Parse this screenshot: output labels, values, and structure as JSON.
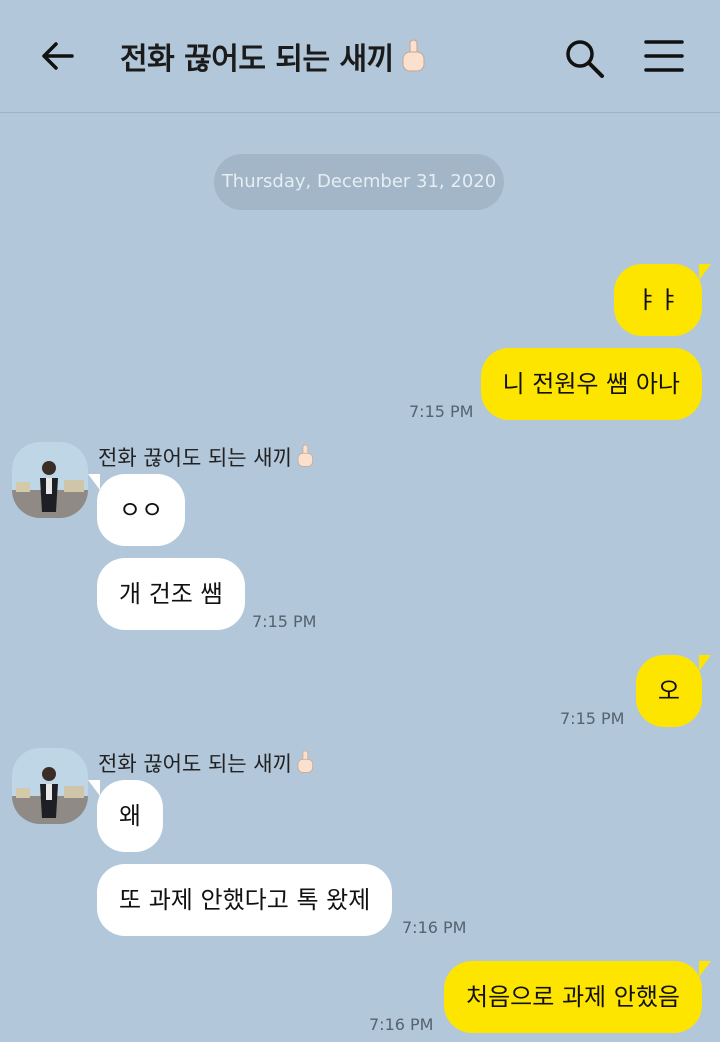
{
  "header": {
    "title": "전화 끊어도 되는 새끼",
    "back_icon": "arrow-left-icon",
    "search_icon": "search-icon",
    "menu_icon": "hamburger-menu-icon",
    "title_emoji": "middle-finger-emoji"
  },
  "date_separator": "Thursday, December 31, 2020",
  "contact": {
    "name": "전화 끊어도 되는 새끼",
    "avatar": "profile-photo"
  },
  "messages": [
    {
      "side": "me",
      "text": "ㅑㅑ"
    },
    {
      "side": "me",
      "text": "니 전원우 쌤 아나",
      "time": "7:15 PM"
    },
    {
      "side": "other",
      "text": "ㅇㅇ"
    },
    {
      "side": "other",
      "text": "개 건조 쌤",
      "time": "7:15 PM"
    },
    {
      "side": "me",
      "text": "오",
      "time": "7:15 PM"
    },
    {
      "side": "other",
      "text": "왜"
    },
    {
      "side": "other",
      "text": "또 과제 안했다고 톡 왔제",
      "time": "7:16 PM"
    },
    {
      "side": "me",
      "text": "처음으로 과제 안했음",
      "time": "7:16 PM"
    }
  ],
  "colors": {
    "background": "#b2c7d9",
    "my_bubble": "#fee500",
    "other_bubble": "#ffffff"
  }
}
